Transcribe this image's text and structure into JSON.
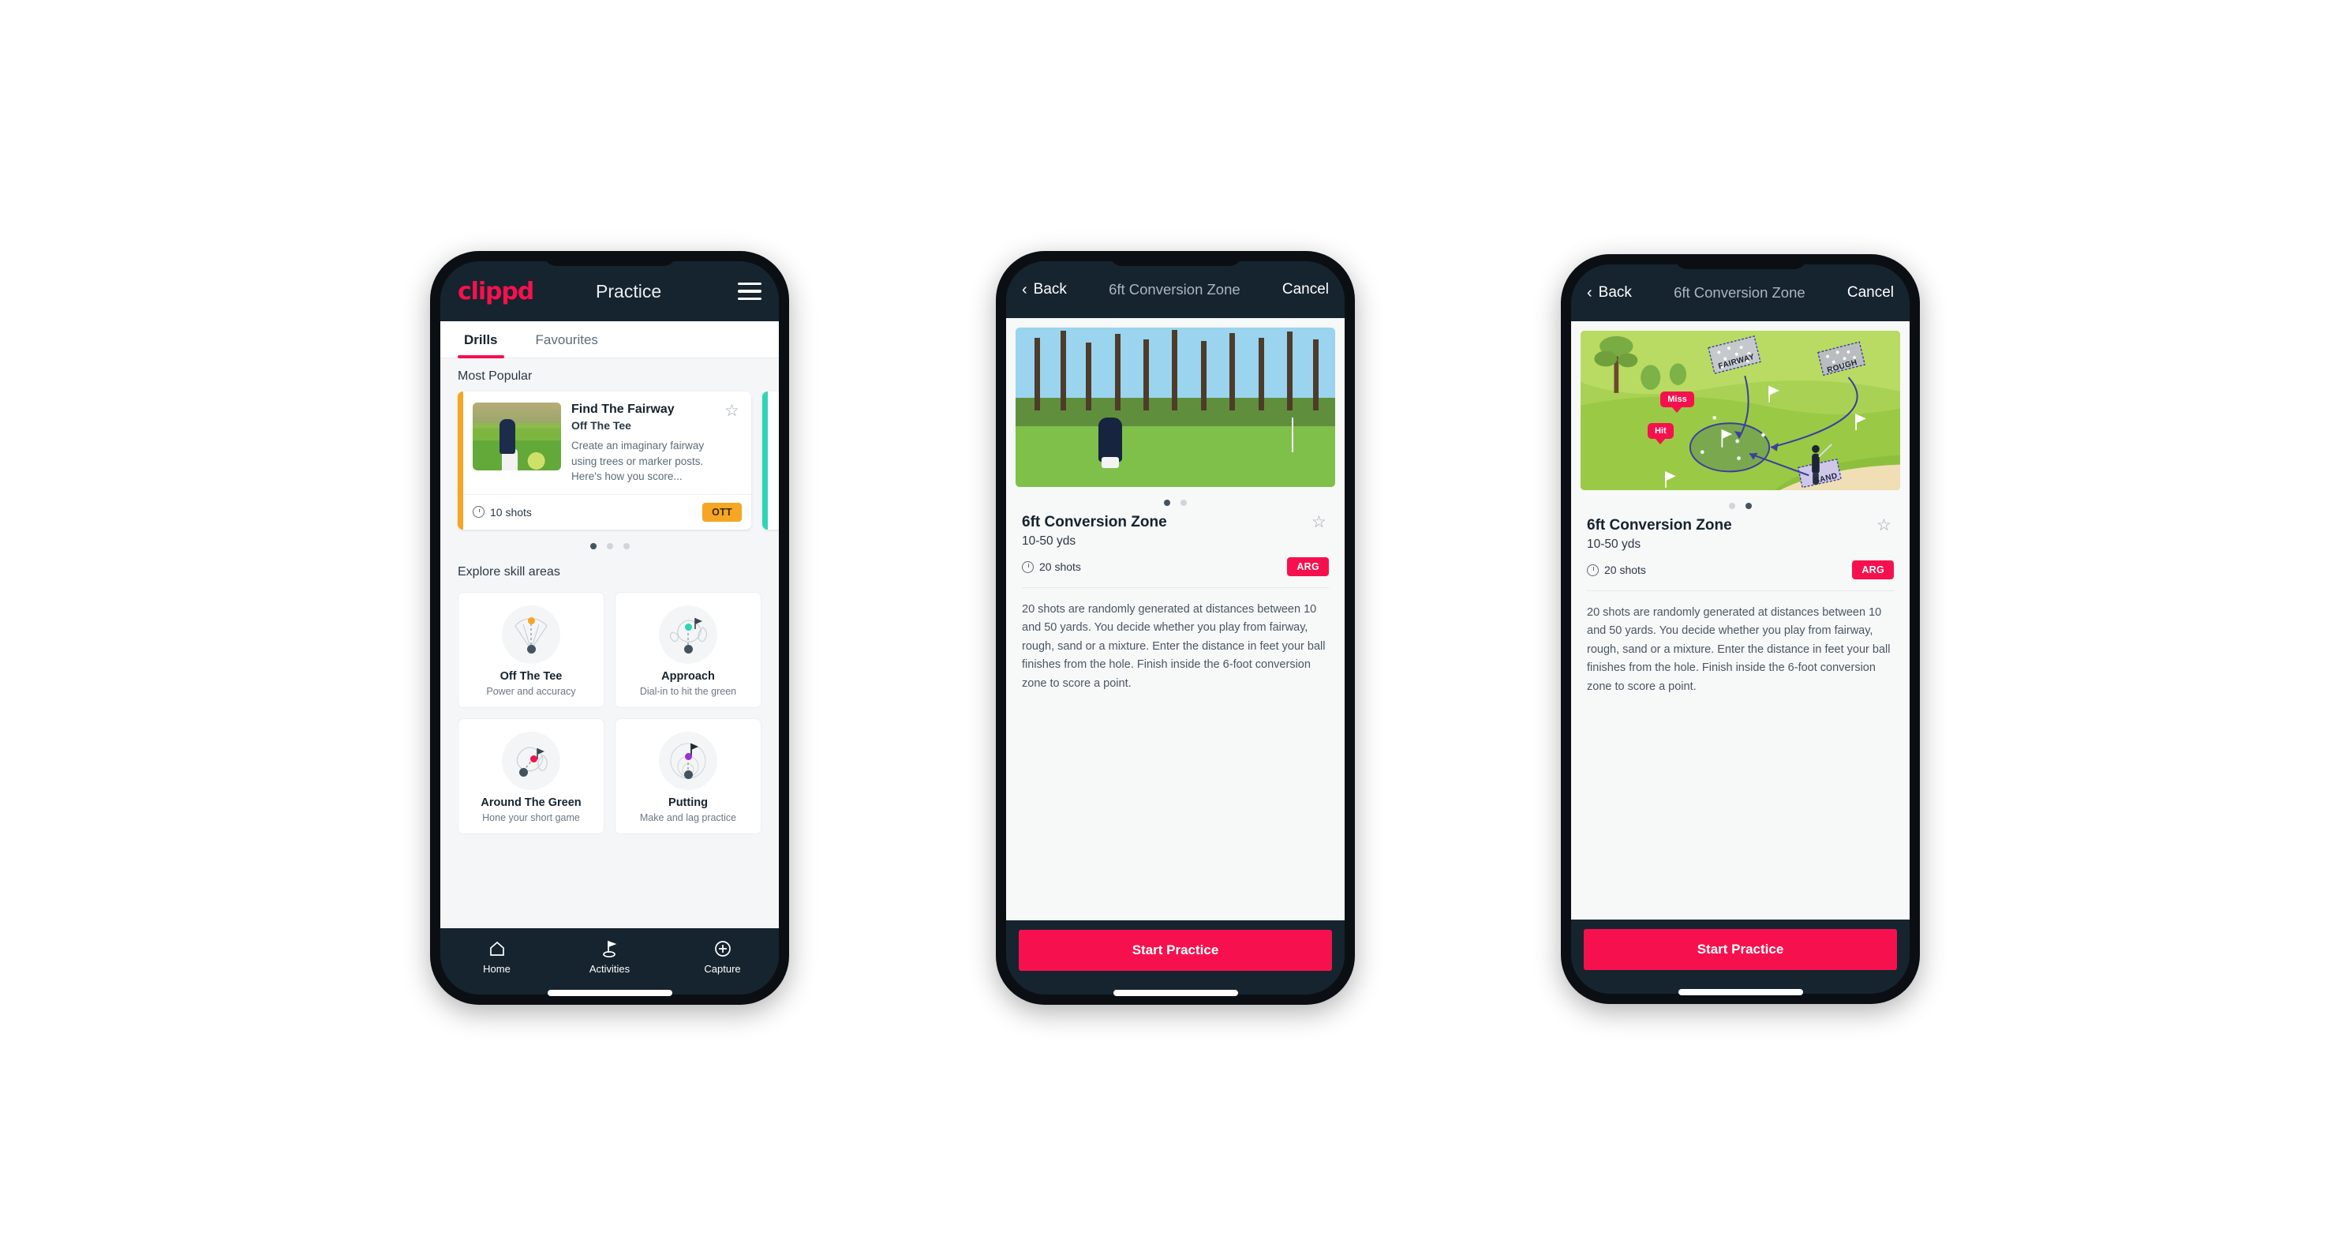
{
  "phone1": {
    "header": {
      "logo": "clippd",
      "title": "Practice",
      "menu_icon": "hamburger-icon"
    },
    "tabs": [
      {
        "label": "Drills",
        "active": true
      },
      {
        "label": "Favourites",
        "active": false
      }
    ],
    "most_popular": {
      "section_label": "Most Popular",
      "card": {
        "name": "Find The Fairway",
        "category": "Off The Tee",
        "description": "Create an imaginary fairway using trees or marker posts. Here's how you score...",
        "shots": "10 shots",
        "badge": "OTT",
        "badge_color": "#f5a623",
        "accent_color": "#f5a623",
        "favourite_icon": "star-outline-icon"
      },
      "dots": 3,
      "active_dot": 0
    },
    "explore": {
      "section_label": "Explore skill areas",
      "cards": [
        {
          "name": "Off The Tee",
          "desc": "Power and accuracy",
          "dot_color": "#f5a623"
        },
        {
          "name": "Approach",
          "desc": "Dial-in to hit the green",
          "dot_color": "#2ed5b6"
        },
        {
          "name": "Around The Green",
          "desc": "Hone your short game",
          "dot_color": "#f6114e"
        },
        {
          "name": "Putting",
          "desc": "Make and lag practice",
          "dot_color": "#9b30d9"
        }
      ]
    },
    "nav": [
      {
        "label": "Home",
        "icon": "home-icon",
        "active": false
      },
      {
        "label": "Activities",
        "icon": "golf-flag-icon",
        "active": true
      },
      {
        "label": "Capture",
        "icon": "plus-circle-icon",
        "active": false
      }
    ]
  },
  "detail": {
    "header": {
      "back": "Back",
      "title": "6ft Conversion Zone",
      "cancel": "Cancel"
    },
    "name": "6ft Conversion Zone",
    "distance": "10-50 yds",
    "shots": "20 shots",
    "badge": "ARG",
    "badge_color": "#f6114e",
    "favourite_icon": "star-outline-icon",
    "description": "20 shots are randomly generated at distances between 10 and 50 yards. You decide whether you play from fairway, rough, sand or a mixture. Enter the distance in feet your ball finishes from the hole. Finish inside the 6-foot conversion zone to score a point.",
    "cta": "Start Practice",
    "dots": 2,
    "phone2_active_dot": 0,
    "phone3_active_dot": 1,
    "map_labels": {
      "fairway": "FAIRWAY",
      "rough": "ROUGH",
      "sand": "SAND",
      "miss": "Miss",
      "hit": "Hit"
    }
  },
  "theme": {
    "brand_pink": "#f6114e",
    "dark_navy": "#16242f",
    "amber": "#f5a623",
    "teal": "#2ed5b6"
  }
}
